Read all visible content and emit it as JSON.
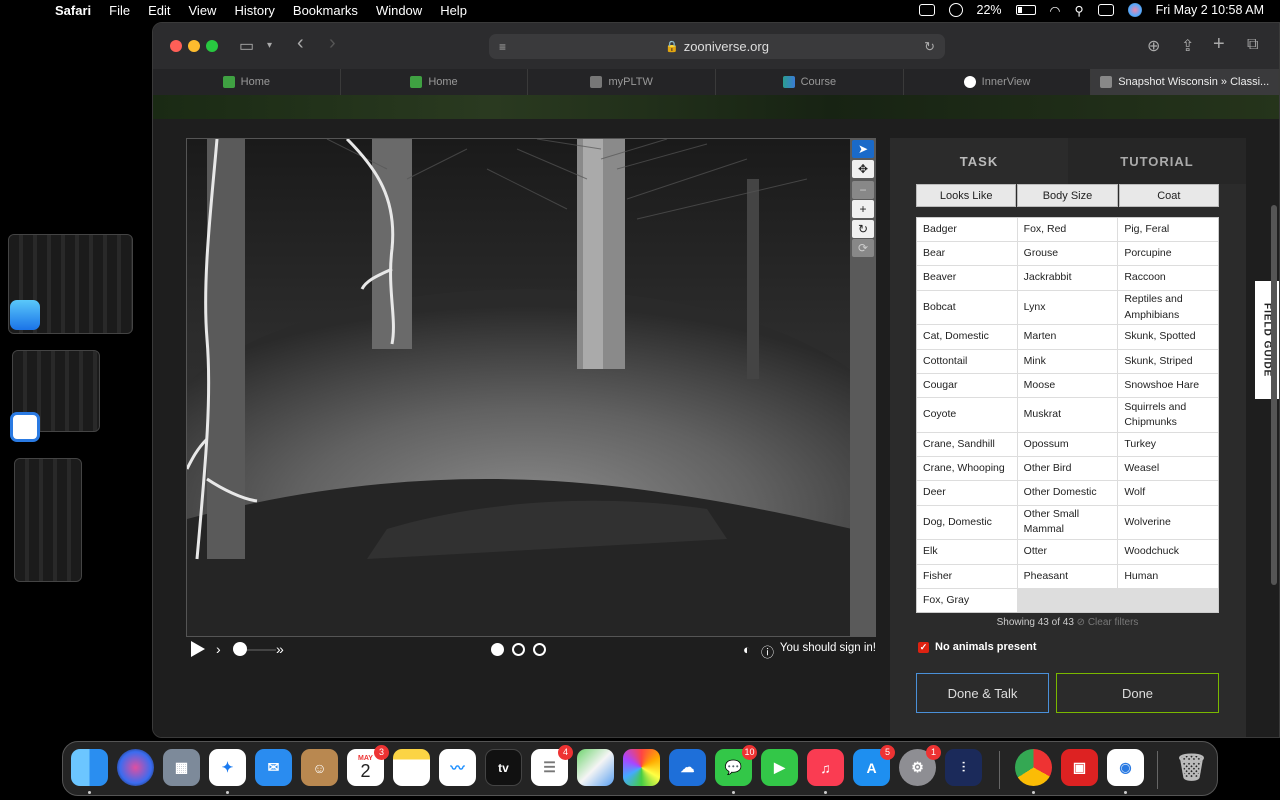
{
  "menubar": {
    "app": "Safari",
    "items": [
      "File",
      "Edit",
      "View",
      "History",
      "Bookmarks",
      "Window",
      "Help"
    ],
    "battery": "22%",
    "clock": "Fri May 2  10:58 AM"
  },
  "browser": {
    "url": "zooniverse.org",
    "tabs": [
      {
        "label": "Home",
        "icon": "google-classroom-icon",
        "color": "#3fa142"
      },
      {
        "label": "Home",
        "icon": "google-classroom-icon",
        "color": "#3fa142"
      },
      {
        "label": "myPLTW",
        "icon": "pltw-icon",
        "color": "#777777"
      },
      {
        "label": "Course",
        "icon": "course-icon",
        "color": "#2b9d8f"
      },
      {
        "label": "InnerView",
        "icon": "innerview-icon",
        "color": "#ffffff"
      },
      {
        "label": "Snapshot Wisconsin » Classi...",
        "icon": "zooniverse-icon",
        "color": "#888888"
      }
    ]
  },
  "classifier": {
    "tabs": [
      "TASK",
      "TUTORIAL"
    ],
    "filters": [
      "Looks Like",
      "Body Size",
      "Coat"
    ],
    "choices": [
      "Badger",
      "Fox, Red",
      "Pig, Feral",
      "Bear",
      "Grouse",
      "Porcupine",
      "Beaver",
      "Jackrabbit",
      "Raccoon",
      "Bobcat",
      "Lynx",
      "Reptiles and Amphibians",
      "Cat, Domestic",
      "Marten",
      "Skunk, Spotted",
      "Cottontail",
      "Mink",
      "Skunk, Striped",
      "Cougar",
      "Moose",
      "Snowshoe Hare",
      "Coyote",
      "Muskrat",
      "Squirrels and Chipmunks",
      "Crane, Sandhill",
      "Opossum",
      "Turkey",
      "Crane, Whooping",
      "Other Bird",
      "Weasel",
      "Deer",
      "Other Domestic",
      "Wolf",
      "Dog, Domestic",
      "Other Small Mammal",
      "Wolverine",
      "Elk",
      "Otter",
      "Woodchuck",
      "Fisher",
      "Pheasant",
      "Human",
      "Fox, Gray"
    ],
    "showing": "Showing 43 of 43",
    "clear_filters": "Clear filters",
    "no_animals": "No animals present",
    "no_animals_checked": true,
    "done_talk": "Done & Talk",
    "done": "Done",
    "field_guide": "FIELD GUIDE",
    "sign_in": "You should sign in!"
  },
  "dock": {
    "calendar_month": "MAY",
    "calendar_day": "2",
    "badges": {
      "calendar": "3",
      "reminders": "4",
      "messages": "10",
      "appstore": "5",
      "settings": "1"
    }
  }
}
